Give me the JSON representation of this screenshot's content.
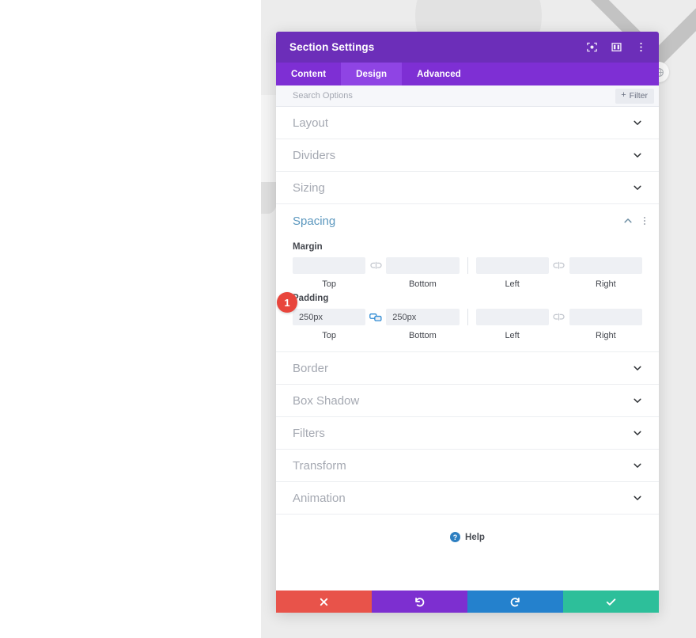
{
  "background": {
    "canvas_color": "#ececec",
    "circle_color": "#e2e2e2",
    "chevron_color": "#c3c3c3",
    "globe_icon": "globe-icon"
  },
  "modal": {
    "title": "Section Settings",
    "titlebar_color": "#6c2eb9",
    "titlebar_icons": [
      {
        "name": "focus-target-icon"
      },
      {
        "name": "split-columns-icon"
      },
      {
        "name": "vertical-dots-icon"
      }
    ],
    "tabs": [
      {
        "label": "Content",
        "active": false
      },
      {
        "label": "Design",
        "active": true
      },
      {
        "label": "Advanced",
        "active": false
      }
    ],
    "search": {
      "placeholder": "Search Options",
      "value": "",
      "filter_label": "Filter",
      "filter_plus": "+"
    },
    "sections": [
      {
        "label": "Layout",
        "state": "collapsed"
      },
      {
        "label": "Dividers",
        "state": "collapsed"
      },
      {
        "label": "Sizing",
        "state": "collapsed"
      },
      {
        "label": "Border",
        "state": "collapsed"
      },
      {
        "label": "Box Shadow",
        "state": "collapsed"
      },
      {
        "label": "Filters",
        "state": "collapsed"
      },
      {
        "label": "Transform",
        "state": "collapsed"
      },
      {
        "label": "Animation",
        "state": "collapsed"
      }
    ],
    "spacing": {
      "label": "Spacing",
      "label_color": "#5b97be",
      "state": "expanded",
      "margin": {
        "title": "Margin",
        "top": {
          "value": "",
          "label": "Top"
        },
        "bottom": {
          "value": "",
          "label": "Bottom"
        },
        "left": {
          "value": "",
          "label": "Left"
        },
        "right": {
          "value": "",
          "label": "Right"
        },
        "link_vertical": "unlinked",
        "link_horizontal": "unlinked"
      },
      "padding": {
        "title": "Padding",
        "top": {
          "value": "250px",
          "label": "Top"
        },
        "bottom": {
          "value": "250px",
          "label": "Bottom"
        },
        "left": {
          "value": "",
          "label": "Left"
        },
        "right": {
          "value": "",
          "label": "Right"
        },
        "link_vertical": "linked",
        "link_horizontal": "unlinked",
        "link_color": "#2f8bd4",
        "step_badge": "1",
        "step_badge_color": "#e8453c"
      }
    },
    "help": {
      "label": "Help",
      "icon_char": "?"
    },
    "actions": [
      {
        "name": "cancel-button",
        "icon": "close-icon",
        "color": "#e8534a"
      },
      {
        "name": "undo-button",
        "icon": "undo-icon",
        "color": "#7d2fd0"
      },
      {
        "name": "redo-button",
        "icon": "redo-icon",
        "color": "#2481cd"
      },
      {
        "name": "save-button",
        "icon": "check-icon",
        "color": "#2dbf9a"
      }
    ]
  }
}
